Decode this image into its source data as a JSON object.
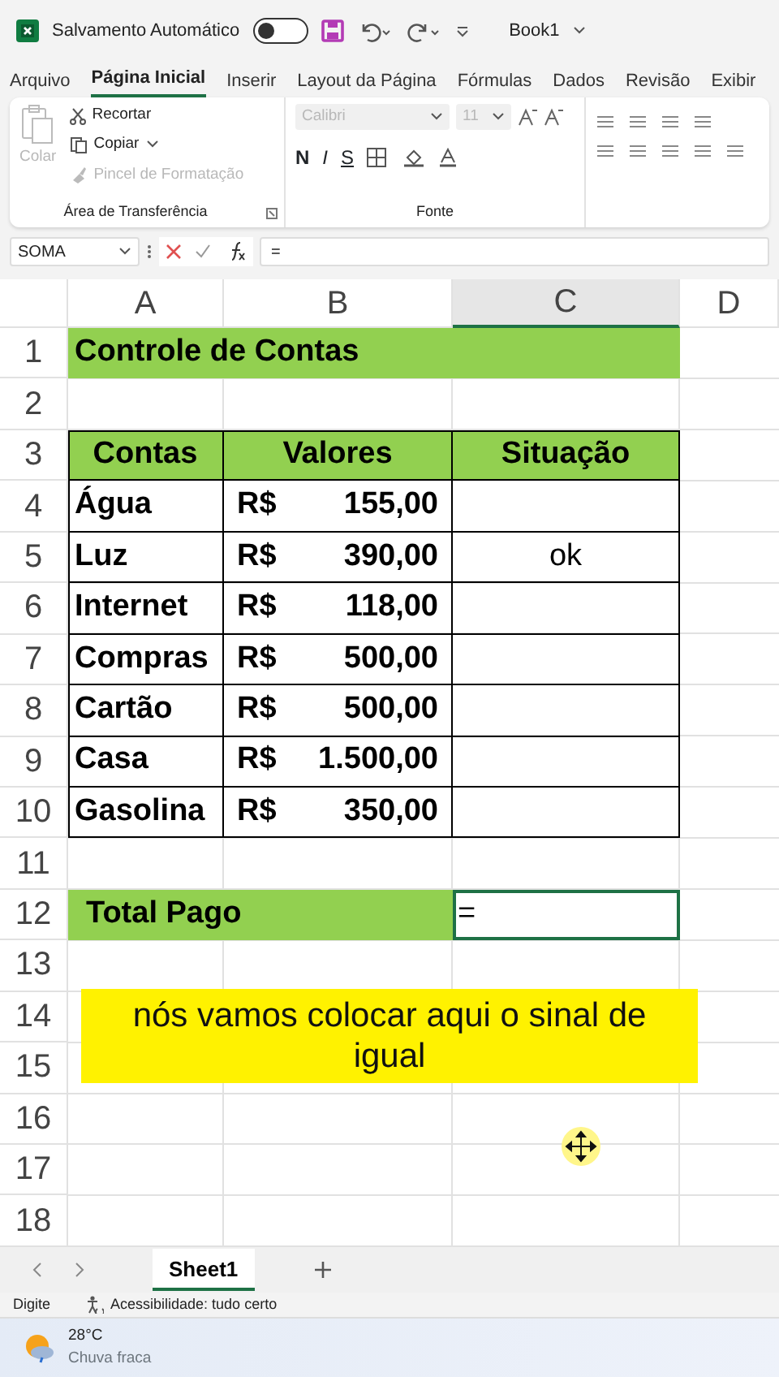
{
  "title_bar": {
    "autosave_label": "Salvamento Automático",
    "autosave_on": false,
    "workbook": "Book1"
  },
  "ribbon_tabs": [
    {
      "label": "Arquivo",
      "selected": false
    },
    {
      "label": "Página Inicial",
      "selected": true
    },
    {
      "label": "Inserir",
      "selected": false
    },
    {
      "label": "Layout da Página",
      "selected": false
    },
    {
      "label": "Fórmulas",
      "selected": false
    },
    {
      "label": "Dados",
      "selected": false
    },
    {
      "label": "Revisão",
      "selected": false
    },
    {
      "label": "Exibir",
      "selected": false
    }
  ],
  "clipboard": {
    "paste": "Colar",
    "cut": "Recortar",
    "copy": "Copiar",
    "format_painter": "Pincel de Formatação",
    "group": "Área de Transferência"
  },
  "font": {
    "name": "Calibri",
    "size": "11",
    "bold": "N",
    "italic": "I",
    "underline": "S",
    "group": "Fonte"
  },
  "formula_bar": {
    "name_box": "SOMA",
    "content": "="
  },
  "columns": [
    {
      "label": "A",
      "selected": false
    },
    {
      "label": "B",
      "selected": false
    },
    {
      "label": "C",
      "selected": true
    },
    {
      "label": "D",
      "selected": false
    }
  ],
  "rows": [
    {
      "number": "1",
      "kind": "title",
      "text": "Controle de Contas"
    },
    {
      "number": "2",
      "kind": "blank"
    },
    {
      "number": "3",
      "kind": "header",
      "cells": [
        "Contas",
        "Valores",
        "Situação"
      ]
    },
    {
      "number": "4",
      "kind": "data",
      "account": "Água",
      "currency": "R$",
      "amount": "155,00"
    },
    {
      "number": "5",
      "kind": "data",
      "account": "Luz",
      "currency": "R$",
      "amount": "390,00",
      "status": "ok"
    },
    {
      "number": "6",
      "kind": "data",
      "account": "Internet",
      "currency": "R$",
      "amount": "118,00"
    },
    {
      "number": "7",
      "kind": "data",
      "account": "Compras",
      "currency": "R$",
      "amount": "500,00"
    },
    {
      "number": "8",
      "kind": "data",
      "account": "Cartão",
      "currency": "R$",
      "amount": "500,00"
    },
    {
      "number": "9",
      "kind": "data",
      "account": "Casa",
      "currency": "R$",
      "amount": "1.500,00"
    },
    {
      "number": "10",
      "kind": "data",
      "account": "Gasolina",
      "currency": "R$",
      "amount": "350,00"
    },
    {
      "number": "11",
      "kind": "blank"
    },
    {
      "number": "12",
      "kind": "total",
      "label": "Total Pago",
      "entry": "=",
      "selected": true
    },
    {
      "number": "13",
      "kind": "blank"
    },
    {
      "number": "14",
      "kind": "blank"
    },
    {
      "number": "15",
      "kind": "blank"
    },
    {
      "number": "16",
      "kind": "blank"
    },
    {
      "number": "17",
      "kind": "blank"
    },
    {
      "number": "18",
      "kind": "blank"
    }
  ],
  "caption": "nós vamos colocar aqui o sinal de igual",
  "sheet_tabs": [
    {
      "label": "Sheet1",
      "selected": true
    }
  ],
  "status_bar": {
    "mode": "Digite",
    "accessibility": "Acessibilidade: tudo certo"
  },
  "taskbar": {
    "temperature": "28°C",
    "weather": "Chuva fraca"
  }
}
